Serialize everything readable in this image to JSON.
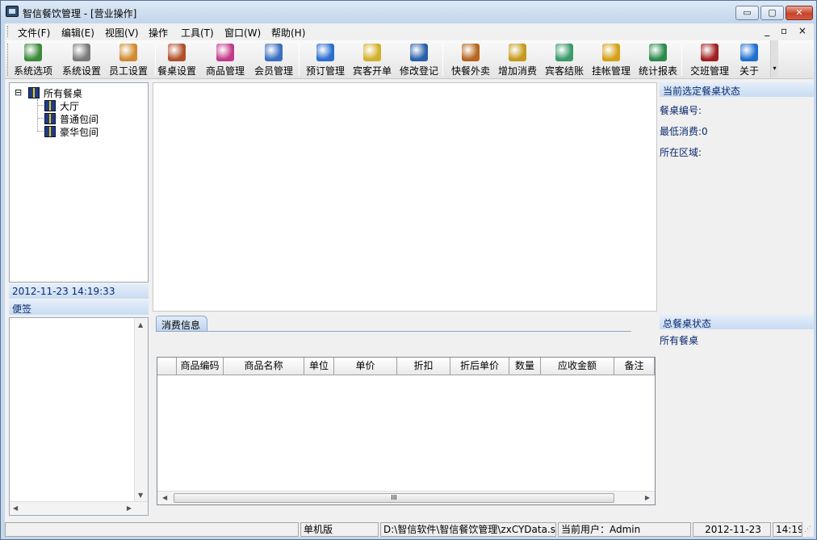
{
  "window": {
    "title": "智信餐饮管理 - [营业操作]",
    "min_glyph": "▭",
    "max_glyph": "▢",
    "close_glyph": "✕"
  },
  "menu": {
    "items": [
      "文件(F)",
      "编辑(E)",
      "视图(V)",
      "操作",
      "工具(T)",
      "窗口(W)",
      "帮助(H)"
    ],
    "mdi_controls": "_ ▫ ×"
  },
  "toolbar": {
    "buttons": [
      {
        "label": "系统选项",
        "icon": "system-options-icon",
        "color": "#3a8a3a"
      },
      {
        "label": "系统设置",
        "icon": "tools-icon",
        "color": "#7a7a7a"
      },
      {
        "label": "员工设置",
        "icon": "employee-icon",
        "color": "#d08a30"
      },
      {
        "label": "餐桌设置",
        "icon": "table-icon",
        "color": "#b0502a"
      },
      {
        "label": "商品管理",
        "icon": "cube-icon",
        "color": "#c23b8a"
      },
      {
        "label": "会员管理",
        "icon": "member-icon",
        "color": "#3a6fbf"
      },
      {
        "label": "预订管理",
        "icon": "clock-icon",
        "color": "#2a6fcf"
      },
      {
        "label": "宾客开单",
        "icon": "order-icon",
        "color": "#d2b12a"
      },
      {
        "label": "修改登记",
        "icon": "edit-user-icon",
        "color": "#2a5fa8"
      },
      {
        "label": "快餐外卖",
        "icon": "burger-icon",
        "color": "#b5651d"
      },
      {
        "label": "增加消费",
        "icon": "add-consume-icon",
        "color": "#c49a1a"
      },
      {
        "label": "宾客结账",
        "icon": "checkout-icon",
        "color": "#3a9a6a"
      },
      {
        "label": "挂帐管理",
        "icon": "money-bag-icon",
        "color": "#d4a017"
      },
      {
        "label": "统计报表",
        "icon": "chart-icon",
        "color": "#2a8a4a"
      },
      {
        "label": "交班管理",
        "icon": "shift-icon",
        "color": "#a02020"
      },
      {
        "label": "关于",
        "icon": "help-icon",
        "color": "#1f6fd0"
      }
    ]
  },
  "tree": {
    "root": "所有餐桌",
    "children": [
      "大厅",
      "普通包间",
      "豪华包间"
    ],
    "expander": "⊟"
  },
  "left": {
    "datetime": "2012-11-23 14:19:33",
    "memo_title": "便签"
  },
  "grid": {
    "tab_label": "消费信息",
    "columns": [
      "商品编码",
      "商品名称",
      "单位",
      "单价",
      "折扣",
      "折后单价",
      "数量",
      "应收金额",
      "备注"
    ],
    "rows": [],
    "hscroll_grip": "III"
  },
  "right": {
    "current_title": "当前选定餐桌状态",
    "fields": [
      "餐桌编号:",
      "最低消费:0",
      "所在区域:"
    ],
    "total_title": "总餐桌状态",
    "total_item": "所有餐桌"
  },
  "status": {
    "edition": "单机版",
    "db_path": "D:\\智信软件\\智信餐饮管理\\zxCYData.sys",
    "user": "当前用户：Admin",
    "date": "2012-11-23",
    "time": "14:19"
  }
}
